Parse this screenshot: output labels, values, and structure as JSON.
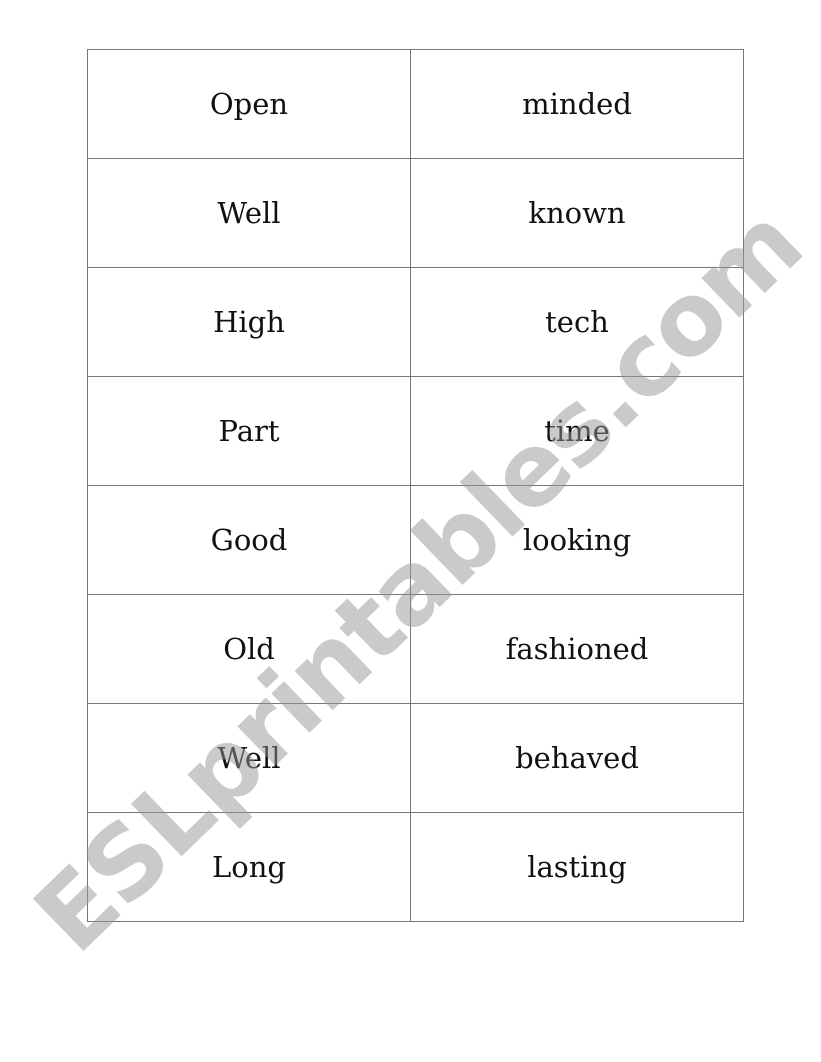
{
  "rows": [
    {
      "left": "Open",
      "right": "minded"
    },
    {
      "left": "Well",
      "right": "known"
    },
    {
      "left": "High",
      "right": "tech"
    },
    {
      "left": "Part",
      "right": "time"
    },
    {
      "left": "Good",
      "right": "looking"
    },
    {
      "left": "Old",
      "right": "fashioned"
    },
    {
      "left": "Well",
      "right": "behaved"
    },
    {
      "left": "Long",
      "right": "lasting"
    }
  ],
  "watermark": "ESLprintables.com"
}
